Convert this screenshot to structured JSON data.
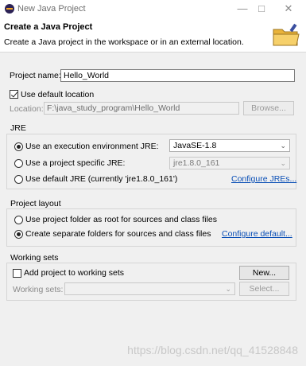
{
  "window": {
    "title": "New Java Project",
    "minimize_glyph": "—",
    "maximize_glyph": "□",
    "close_glyph": "✕"
  },
  "header": {
    "title": "Create a Java Project",
    "description": "Create a Java project in the workspace or in an external location."
  },
  "project": {
    "name_label": "Project name:",
    "name_value": "Hello_World",
    "use_default_label": "Use default location",
    "use_default_checked": true,
    "location_label": "Location:",
    "location_value": "F:\\java_study_program\\Hello_World",
    "browse_label": "Browse..."
  },
  "jre": {
    "group_title": "JRE",
    "option_env_label": "Use an execution environment JRE:",
    "env_value": "JavaSE-1.8",
    "option_specific_label": "Use a project specific JRE:",
    "specific_value": "jre1.8.0_161",
    "option_default_label": "Use default JRE (currently 'jre1.8.0_161')",
    "configure_link": "Configure JREs..."
  },
  "layout": {
    "group_title": "Project layout",
    "option_root_label": "Use project folder as root for sources and class files",
    "option_separate_label": "Create separate folders for sources and class files",
    "configure_link": "Configure default..."
  },
  "working_sets": {
    "group_title": "Working sets",
    "add_label": "Add project to working sets",
    "new_label": "New...",
    "sets_label": "Working sets:",
    "select_label": "Select..."
  },
  "watermark": "https://blog.csdn.net/qq_41528848",
  "colors": {
    "link": "#0a4fb6",
    "folder_yellow": "#f2c34a"
  }
}
